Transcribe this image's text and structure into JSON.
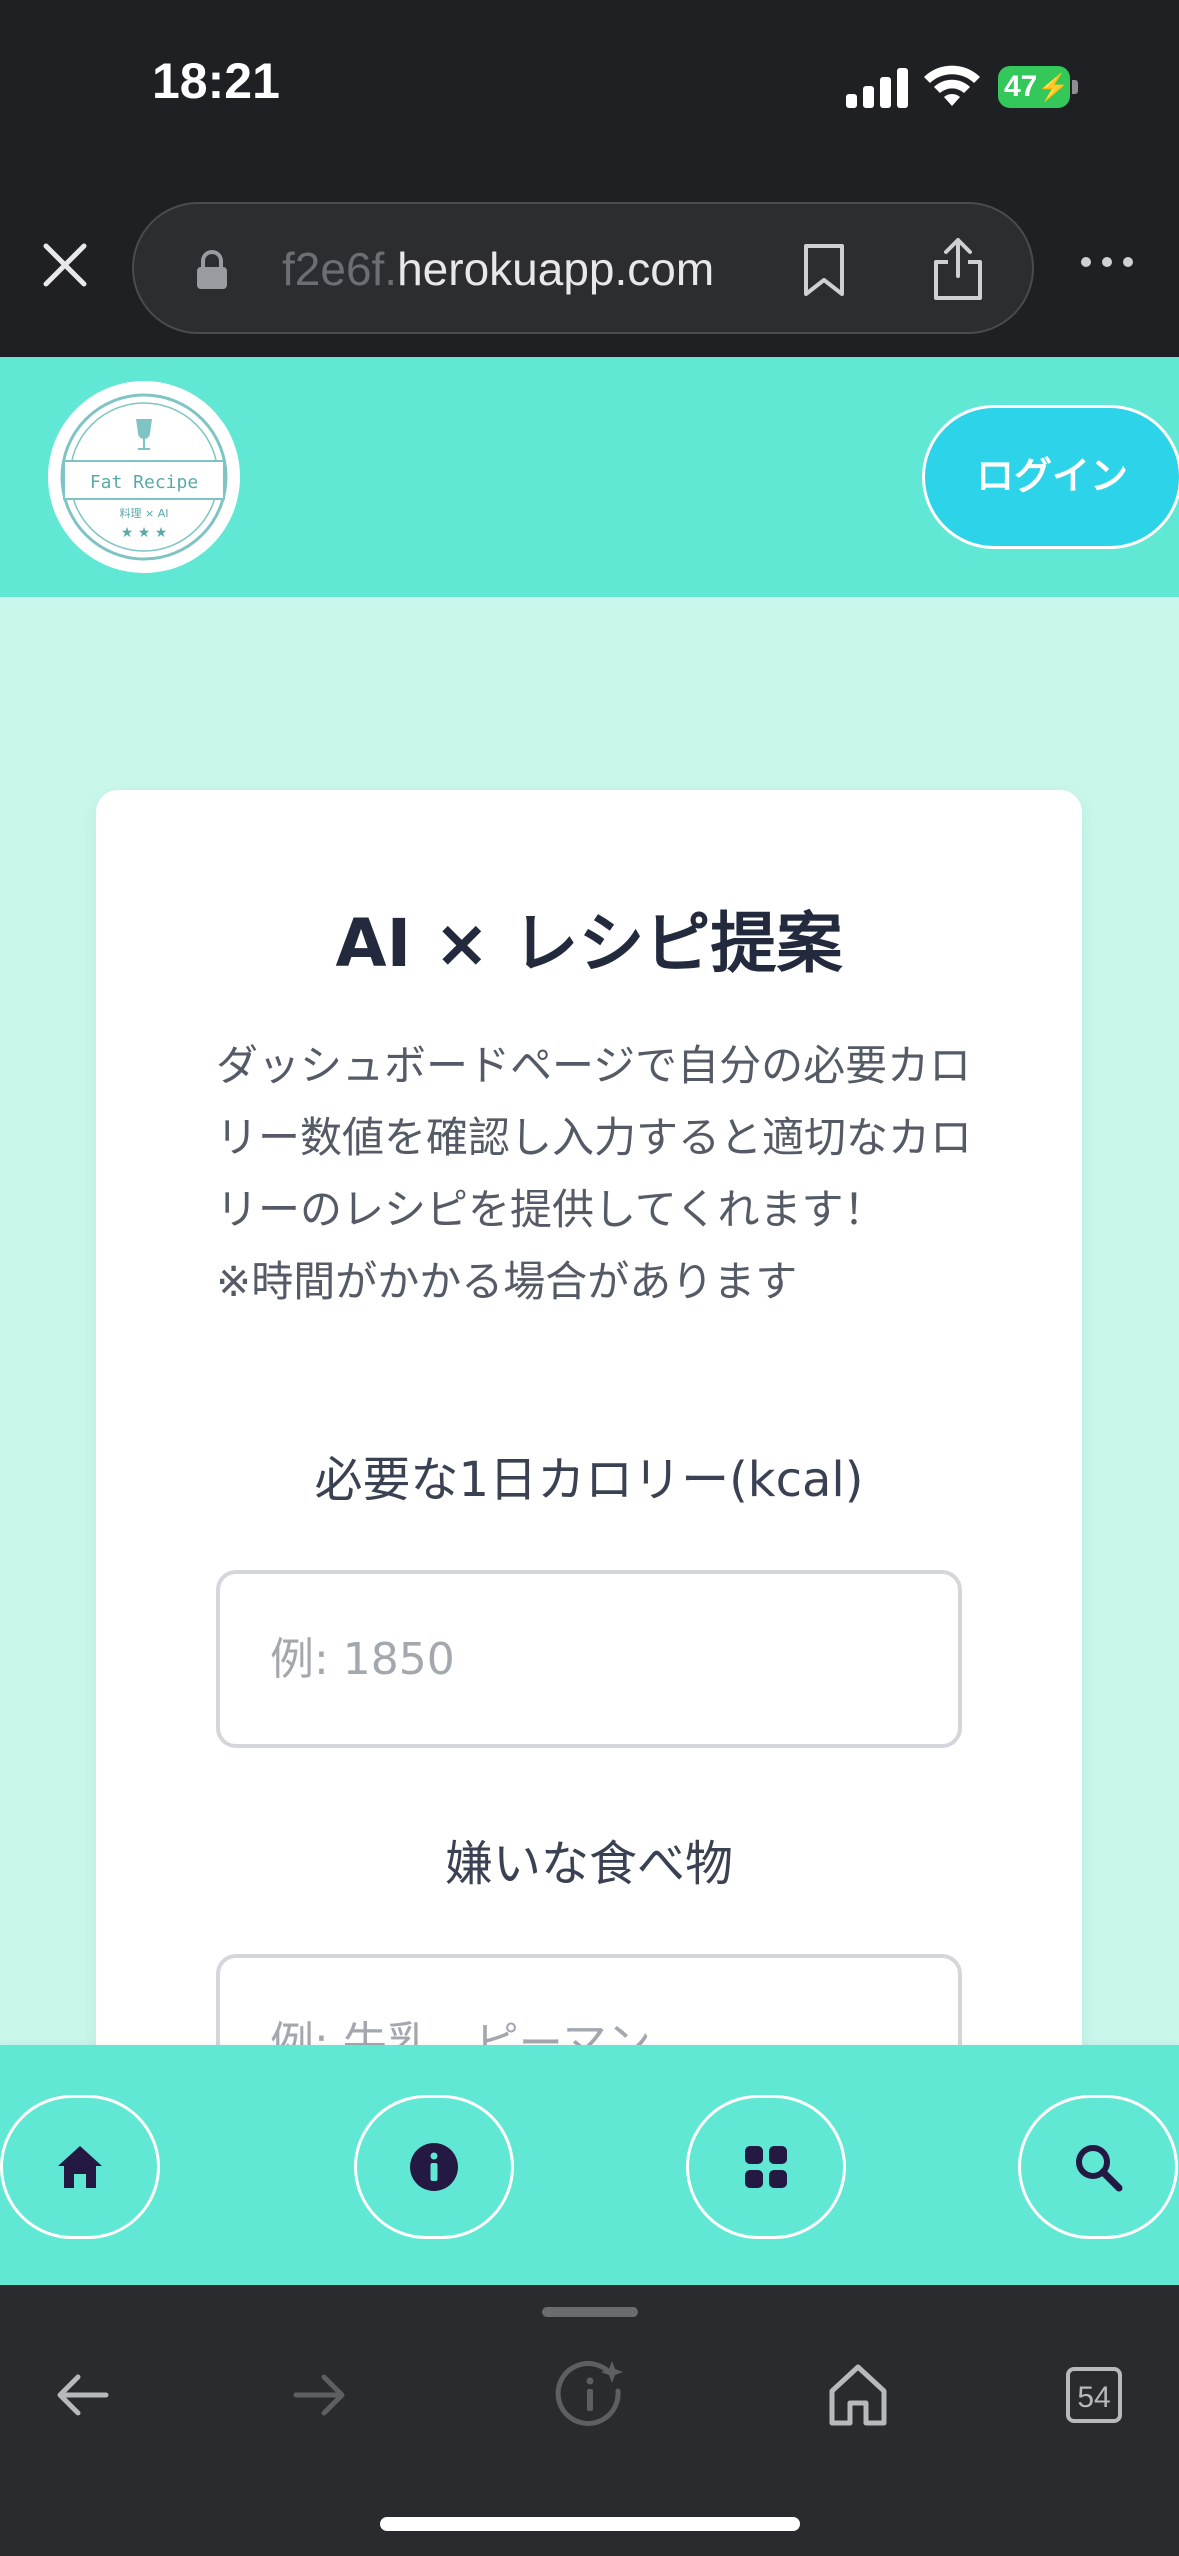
{
  "status_bar": {
    "time": "18:21",
    "battery_level": "47"
  },
  "browser": {
    "url_faded": "f2e6f.",
    "url_main": "herokuapp.com"
  },
  "header": {
    "logo_title": "Fat Recipe",
    "logo_subtitle": "料理 × AI",
    "login_label": "ログイン"
  },
  "card": {
    "title": "AI × レシピ提案",
    "description": "ダッシュボードページで自分の必要カロリー数値を確認し入力すると適切なカロリーのレシピを提供してくれます！",
    "note": "※時間がかかる場合があります",
    "calorie_label": "必要な1日カロリー(kcal)",
    "calorie_placeholder": "例: 1850",
    "dislike_label": "嫌いな食べ物",
    "dislike_placeholder": "例: 牛乳、ピーマン"
  },
  "bottom_nav": {
    "items": [
      "home-icon",
      "info-icon",
      "grid-icon",
      "search-icon"
    ]
  },
  "browser_toolbar": {
    "tab_count": "54"
  },
  "colors": {
    "header_bg": "#61e8d4",
    "page_bg": "#c9f7ec",
    "login_btn": "#2dd3e8",
    "title_text": "#232a3d"
  }
}
